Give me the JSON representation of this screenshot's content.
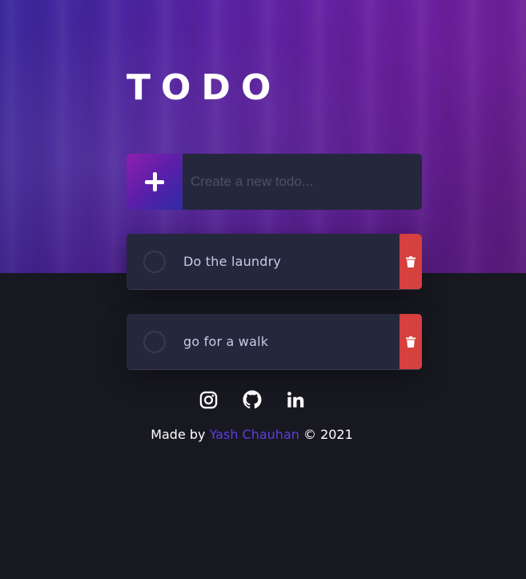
{
  "app": {
    "title": "TODO"
  },
  "new_todo": {
    "placeholder": "Create a new todo...",
    "value": ""
  },
  "todos": [
    {
      "text": "Do the laundry",
      "completed": false
    },
    {
      "text": "go for a walk",
      "completed": false
    }
  ],
  "social": {
    "icons": [
      "instagram-icon",
      "github-icon",
      "linkedin-icon"
    ]
  },
  "footer": {
    "prefix": "Made by",
    "author": "Yash Chauhan",
    "suffix": "© 2021"
  },
  "colors": {
    "background": "#181820",
    "card": "#25273c",
    "text": "#c8cbe7",
    "delete": "#d6403e",
    "accent_link": "#5b3fe0",
    "gradient_start": "#8e1fb0",
    "gradient_end": "#2d2ca6"
  }
}
